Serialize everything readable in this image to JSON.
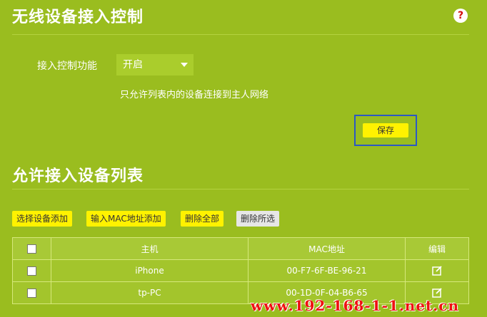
{
  "header": {
    "title": "无线设备接入控制",
    "help_icon_text": "?"
  },
  "control": {
    "label": "接入控制功能",
    "selected_value": "开启",
    "note": "只允许列表内的设备连接到主人网络",
    "save_label": "保存"
  },
  "list": {
    "title": "允许接入设备列表",
    "buttons": {
      "select_add": "选择设备添加",
      "mac_add": "输入MAC地址添加",
      "delete_all": "删除全部",
      "delete_selected": "删除所选"
    },
    "columns": {
      "host": "主机",
      "mac": "MAC地址",
      "edit": "编辑"
    },
    "rows": [
      {
        "host": "iPhone",
        "mac": "00-F7-6F-BE-96-21"
      },
      {
        "host": "tp-PC",
        "mac": "00-1D-0F-04-B6-65"
      }
    ]
  },
  "watermark": {
    "text": "www.192-168-1-1.net.cn"
  },
  "colors": {
    "background": "#9abd1f",
    "button_yellow": "#fff200",
    "save_highlight": "#2b58c4",
    "help_red": "#d30d0d"
  }
}
